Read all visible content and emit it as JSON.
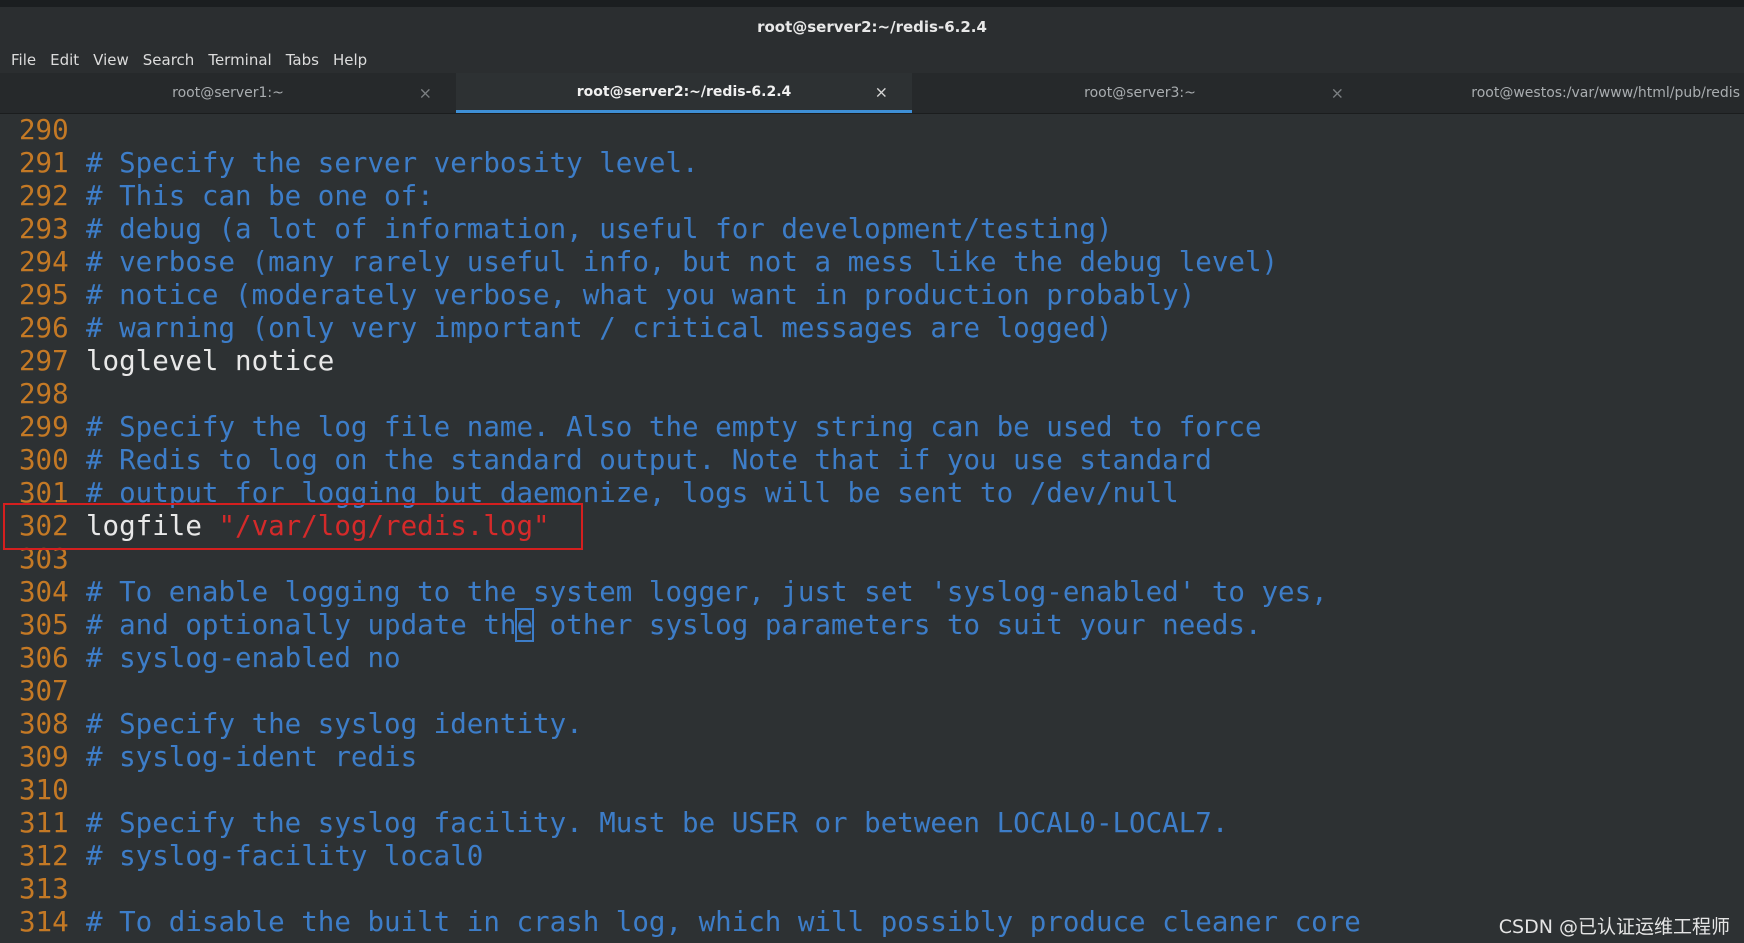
{
  "window": {
    "title": "root@server2:~/redis-6.2.4"
  },
  "menu": [
    "File",
    "Edit",
    "View",
    "Search",
    "Terminal",
    "Tabs",
    "Help"
  ],
  "tabs": [
    {
      "label": "root@server1:~",
      "active": false,
      "close": "×"
    },
    {
      "label": "root@server2:~/redis-6.2.4",
      "active": true,
      "close": "×"
    },
    {
      "label": "root@server3:~",
      "active": false,
      "close": "×"
    },
    {
      "label": "root@westos:/var/www/html/pub/redis",
      "active": false,
      "close": ""
    }
  ],
  "lines": [
    {
      "num": "290",
      "kind": "blank",
      "text": ""
    },
    {
      "num": "291",
      "kind": "comment",
      "text": "# Specify the server verbosity level."
    },
    {
      "num": "292",
      "kind": "comment",
      "text": "# This can be one of:"
    },
    {
      "num": "293",
      "kind": "comment",
      "text": "# debug (a lot of information, useful for development/testing)"
    },
    {
      "num": "294",
      "kind": "comment",
      "text": "# verbose (many rarely useful info, but not a mess like the debug level)"
    },
    {
      "num": "295",
      "kind": "comment",
      "text": "# notice (moderately verbose, what you want in production probably)"
    },
    {
      "num": "296",
      "kind": "comment",
      "text": "# warning (only very important / critical messages are logged)"
    },
    {
      "num": "297",
      "kind": "plain",
      "text": "loglevel notice"
    },
    {
      "num": "298",
      "kind": "blank",
      "text": ""
    },
    {
      "num": "299",
      "kind": "comment",
      "text": "# Specify the log file name. Also the empty string can be used to force"
    },
    {
      "num": "300",
      "kind": "comment",
      "text": "# Redis to log on the standard output. Note that if you use standard"
    },
    {
      "num": "301",
      "kind": "comment",
      "text": "# output for logging but daemonize, logs will be sent to /dev/null"
    },
    {
      "num": "302",
      "kind": "directive",
      "text": "logfile ",
      "value": "\"/var/log/redis.log\""
    },
    {
      "num": "303",
      "kind": "blank",
      "text": ""
    },
    {
      "num": "304",
      "kind": "comment",
      "text": "# To enable logging to the system logger, just set 'syslog-enabled' to yes,"
    },
    {
      "num": "305",
      "kind": "cursor",
      "before": "# and optionally update th",
      "cursor": "e",
      "after": " other syslog parameters to suit your needs."
    },
    {
      "num": "306",
      "kind": "comment",
      "text": "# syslog-enabled no"
    },
    {
      "num": "307",
      "kind": "blank",
      "text": ""
    },
    {
      "num": "308",
      "kind": "comment",
      "text": "# Specify the syslog identity."
    },
    {
      "num": "309",
      "kind": "comment",
      "text": "# syslog-ident redis"
    },
    {
      "num": "310",
      "kind": "blank",
      "text": ""
    },
    {
      "num": "311",
      "kind": "comment",
      "text": "# Specify the syslog facility. Must be USER or between LOCAL0-LOCAL7."
    },
    {
      "num": "312",
      "kind": "comment",
      "text": "# syslog-facility local0"
    },
    {
      "num": "313",
      "kind": "blank",
      "text": ""
    },
    {
      "num": "314",
      "kind": "comment",
      "text": "# To disable the built in crash log, which will possibly produce cleaner core"
    }
  ],
  "watermark": "CSDN @已认证运维工程师",
  "colors": {
    "line_number": "#c47925",
    "comment": "#3d7dc8",
    "string": "#d42a2a",
    "highlight_box": "#d41f1f",
    "background": "#2d3133"
  }
}
